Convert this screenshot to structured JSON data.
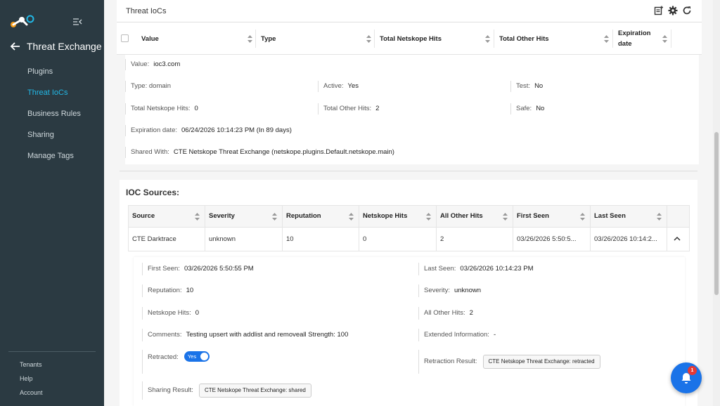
{
  "sidebar": {
    "section_title": "Threat Exchange",
    "items": [
      {
        "label": "Plugins"
      },
      {
        "label": "Threat IoCs"
      },
      {
        "label": "Business Rules"
      },
      {
        "label": "Sharing"
      },
      {
        "label": "Manage Tags"
      }
    ],
    "active_index": 1,
    "bottom_items": [
      {
        "label": "Tenants"
      },
      {
        "label": "Help"
      },
      {
        "label": "Account"
      }
    ]
  },
  "panel": {
    "title": "Threat IoCs"
  },
  "ioc_table": {
    "columns": [
      "Value",
      "Type",
      "Total Netskope Hits",
      "Total Other Hits",
      "Expiration date"
    ]
  },
  "ioc_detail": {
    "value": {
      "label": "Value:",
      "val": "ioc3.com"
    },
    "type": {
      "label": "Type: domain",
      "val": ""
    },
    "active": {
      "label": "Active:",
      "val": "Yes"
    },
    "test": {
      "label": "Test:",
      "val": "No"
    },
    "netskope_hits": {
      "label": "Total Netskope Hits:",
      "val": "0"
    },
    "other_hits": {
      "label": "Total Other Hits:",
      "val": "2"
    },
    "safe": {
      "label": "Safe:",
      "val": "No"
    },
    "expiration": {
      "label": "Expiration date:",
      "val": "06/24/2026 10:14:23 PM (In 89 days)"
    },
    "shared_with": {
      "label": "Shared With:",
      "val": "CTE Netskope Threat Exchange (netskope.plugins.Default.netskope.main)"
    }
  },
  "sources": {
    "title": "IOC Sources:",
    "columns": [
      "Source",
      "Severity",
      "Reputation",
      "Netskope Hits",
      "All Other Hits",
      "First Seen",
      "Last Seen"
    ],
    "row": {
      "source": "CTE Darktrace",
      "severity": "unknown",
      "reputation": "10",
      "netskope_hits": "0",
      "other_hits": "2",
      "first_seen": "03/26/2026 5:50:5...",
      "last_seen": "03/26/2026 10:14:2..."
    },
    "detail": {
      "first_seen": {
        "label": "First Seen:",
        "val": "03/26/2026 5:50:55 PM"
      },
      "last_seen": {
        "label": "Last Seen:",
        "val": "03/26/2026 10:14:23 PM"
      },
      "reputation": {
        "label": "Reputation:",
        "val": "10"
      },
      "severity": {
        "label": "Severity:",
        "val": "unknown"
      },
      "netskope_hits": {
        "label": "Netskope Hits:",
        "val": "0"
      },
      "other_hits": {
        "label": "All Other Hits:",
        "val": "2"
      },
      "comments": {
        "label": "Comments:",
        "val": "Testing upsert with addlist and removeall Strength: 100"
      },
      "extended": {
        "label": "Extended Information:",
        "val": "-"
      },
      "retracted": {
        "label": "Retracted:",
        "toggle": "Yes"
      },
      "retraction_result": {
        "label": "Retraction Result:",
        "chip": "CTE Netskope Threat Exchange: retracted"
      },
      "sharing_result": {
        "label": "Sharing Result:",
        "chip": "CTE Netskope Threat Exchange: shared"
      }
    }
  },
  "notifications": {
    "badge_count": "1"
  },
  "colors": {
    "sidebar_bg": "#2b3a42",
    "accent": "#22b8e6",
    "primary": "#1a73e8",
    "badge": "#e53935"
  },
  "icons": [
    "logo-icon",
    "collapse-menu-icon",
    "back-arrow-icon",
    "add-note-icon",
    "gear-icon",
    "refresh-icon",
    "sort-icon",
    "chevron-up-icon",
    "bell-icon"
  ]
}
